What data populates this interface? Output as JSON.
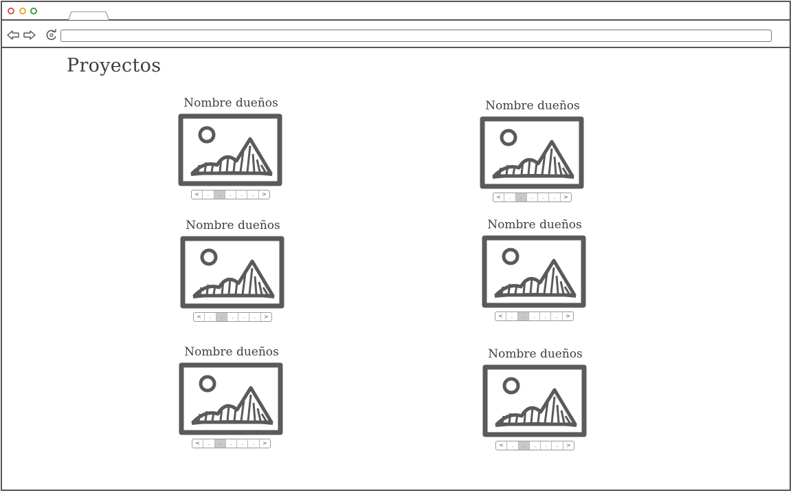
{
  "page": {
    "title": "Proyectos"
  },
  "cards": [
    {
      "title": "Nombre dueños",
      "pager": [
        "<",
        ".",
        ".",
        ".",
        ".",
        ".",
        ">"
      ],
      "active_page": 2
    },
    {
      "title": "Nombre dueños",
      "pager": [
        "<",
        ".",
        ".",
        ".",
        ".",
        ".",
        ">"
      ],
      "active_page": 2
    },
    {
      "title": "Nombre dueños",
      "pager": [
        "<",
        ".",
        ".",
        ".",
        ".",
        ".",
        ">"
      ],
      "active_page": 2
    },
    {
      "title": "Nombre dueños",
      "pager": [
        "<",
        ".",
        ".",
        ".",
        ".",
        ".",
        ">"
      ],
      "active_page": 2
    },
    {
      "title": "Nombre dueños",
      "pager": [
        "<",
        ".",
        ".",
        ".",
        ".",
        ".",
        ">"
      ],
      "active_page": 2
    },
    {
      "title": "Nombre dueños",
      "pager": [
        "<",
        ".",
        ".",
        ".",
        ".",
        ".",
        ">"
      ],
      "active_page": 2
    }
  ],
  "icons": {
    "back": "back-arrow-icon",
    "forward": "forward-arrow-icon",
    "reload": "reload-icon",
    "image": "image-placeholder-icon"
  },
  "colors": {
    "stroke": "#555555",
    "active_page": "#c8c8c8"
  }
}
